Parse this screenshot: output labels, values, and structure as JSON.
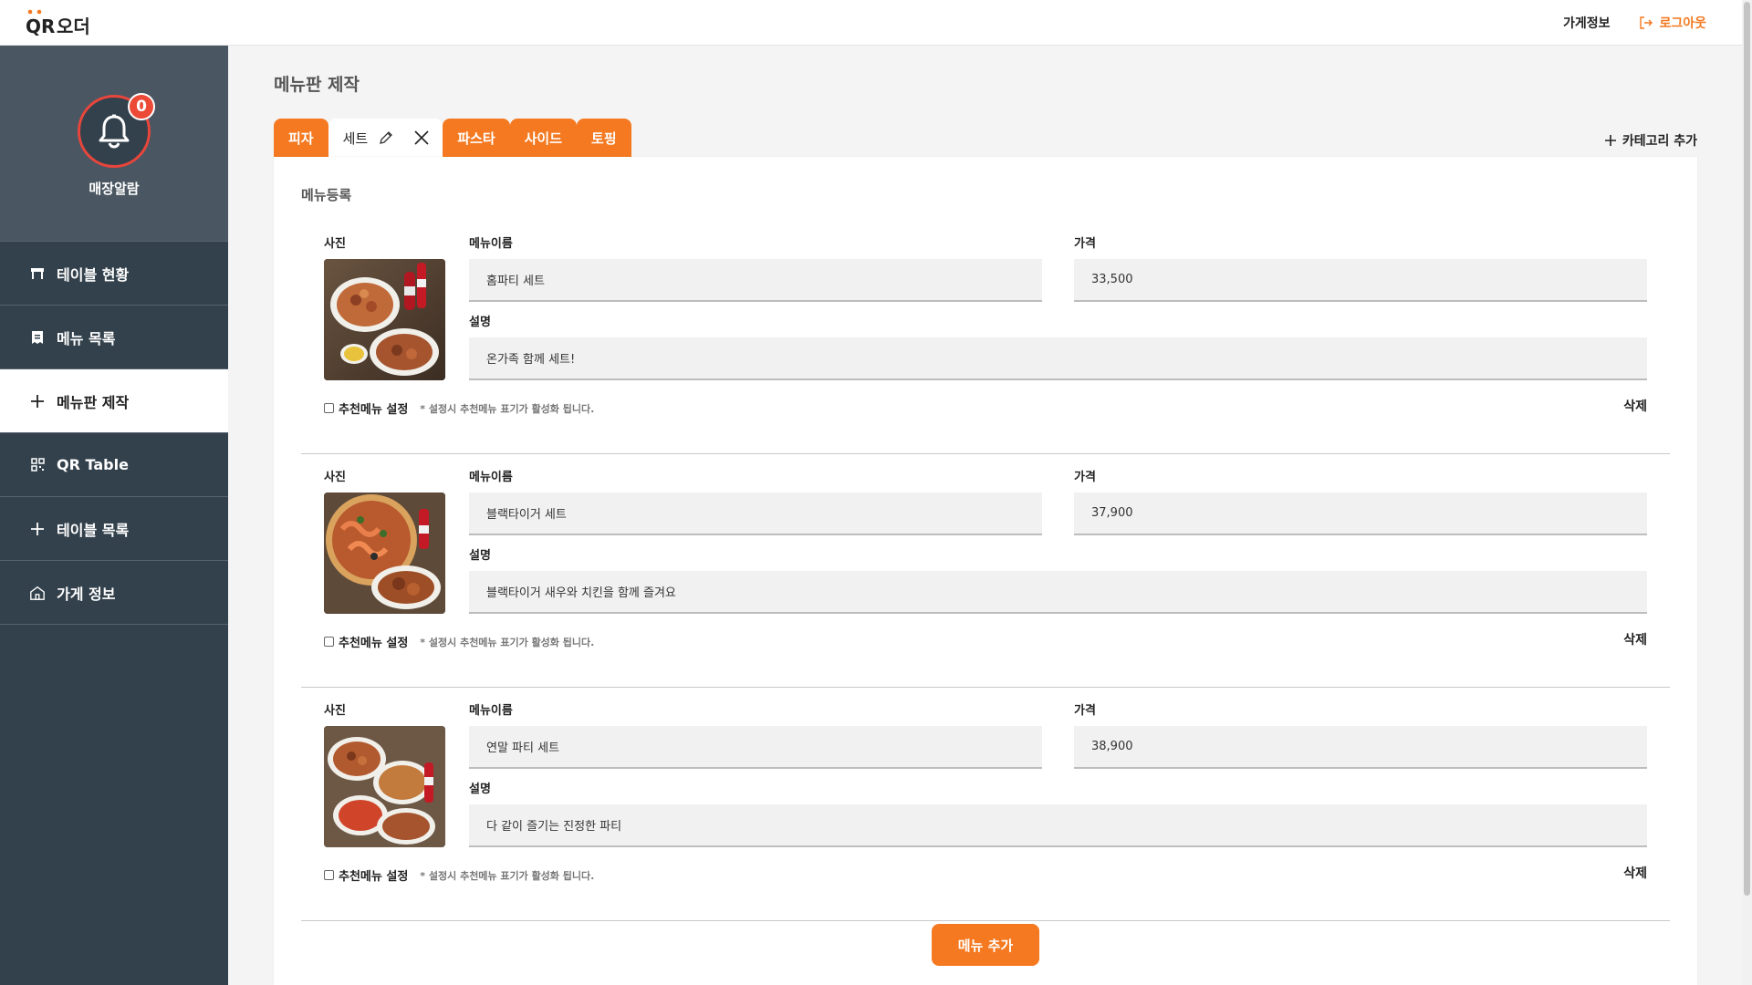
{
  "header": {
    "logo_text": "QR 오더",
    "store_info_label": "가게정보",
    "logout_label": "로그아웃"
  },
  "sidebar": {
    "alarm": {
      "count": "0",
      "label": "매장알람"
    },
    "items": [
      {
        "label": "테이블 현황",
        "icon": "table-icon",
        "active": false
      },
      {
        "label": "메뉴 목록",
        "icon": "menu-doc-icon",
        "active": false
      },
      {
        "label": "메뉴판 제작",
        "icon": "plus-icon",
        "active": true
      },
      {
        "label": "QR Table",
        "icon": "qr-icon",
        "active": false
      },
      {
        "label": "테이블 목록",
        "icon": "plus-icon",
        "active": false
      },
      {
        "label": "가게 정보",
        "icon": "store-icon",
        "active": false
      }
    ]
  },
  "page": {
    "title": "메뉴판 제작",
    "tabs": [
      {
        "label": "피자",
        "active": false
      },
      {
        "label": "세트",
        "active": true
      },
      {
        "label": "파스타",
        "active": false
      },
      {
        "label": "사이드",
        "active": false
      },
      {
        "label": "토핑",
        "active": false
      }
    ],
    "add_category_label": "카테고리 추가",
    "section_title": "메뉴등록",
    "labels": {
      "photo": "사진",
      "name": "메뉴이름",
      "price": "가격",
      "desc": "설명",
      "recommend": "추천메뉴 설정",
      "recommend_note": "* 설정시 추천메뉴 표기가 활성화 됩니다.",
      "delete": "삭제"
    },
    "menus": [
      {
        "name": "홈파티 세트",
        "price": "33,500",
        "desc": "온가족 함께 세트!",
        "recommended": false
      },
      {
        "name": "블랙타이거 세트",
        "price": "37,900",
        "desc": "블랙타이거 새우와 치킨을 함께 즐겨요",
        "recommended": false
      },
      {
        "name": "연말 파티 세트",
        "price": "38,900",
        "desc": "다 같이 즐기는 진정한 파티",
        "recommended": false
      }
    ],
    "add_menu_label": "메뉴 추가"
  },
  "colors": {
    "accent": "#f47920",
    "sidebar_bg": "#33414c",
    "alarm_bg": "#4a5762",
    "badge": "#ec4a37"
  }
}
